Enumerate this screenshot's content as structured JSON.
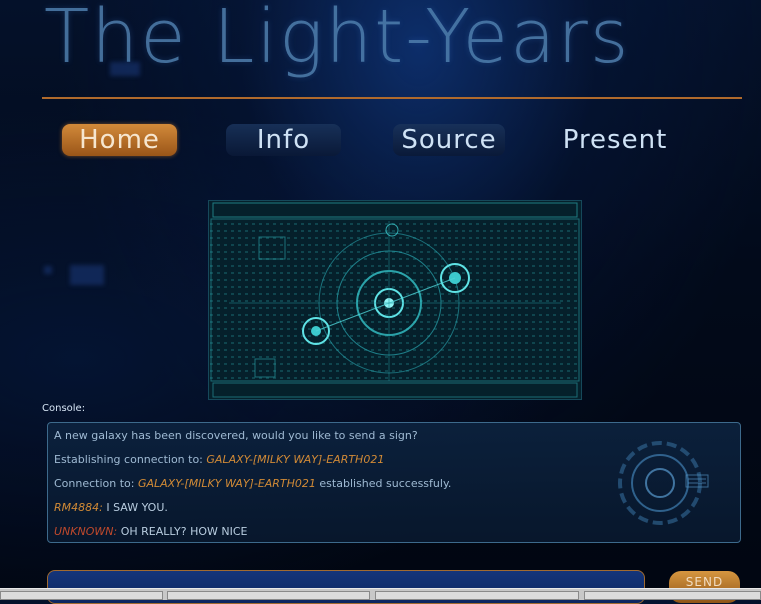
{
  "site": {
    "title": "The Light-Years"
  },
  "nav": {
    "items": [
      {
        "label": "Home",
        "active": true
      },
      {
        "label": "Info",
        "active": false
      },
      {
        "label": "Source",
        "active": false
      },
      {
        "label": "Present",
        "active": false
      }
    ]
  },
  "console": {
    "label": "Console:",
    "lines": {
      "l1": "A new galaxy has been discovered, would you like to send a sign?",
      "l2_prefix": "Establishing connection to: ",
      "l2_target": "GALAXY-[MILKY WAY]-EARTH021",
      "l3_prefix": "Connection to: ",
      "l3_target": "GALAXY-[MILKY WAY]-EARTH021",
      "l3_suffix": " established successfuly.",
      "l4_user": "RM4884:",
      "l4_msg": " I SAW YOU.",
      "l5_user": "UNKNOWN:",
      "l5_msg": " OH REALLY? HOW NICE"
    }
  },
  "compose": {
    "input_value": "",
    "send_label": "SEND"
  },
  "colors": {
    "accent_orange": "#d28a3a",
    "divider": "#b06a2c",
    "highlight": "#d18a36",
    "unknown_user": "#c0492c"
  },
  "icons": {
    "hud_image": "sci-fi-hud-display",
    "console_decor": "radar-ring-icon"
  }
}
